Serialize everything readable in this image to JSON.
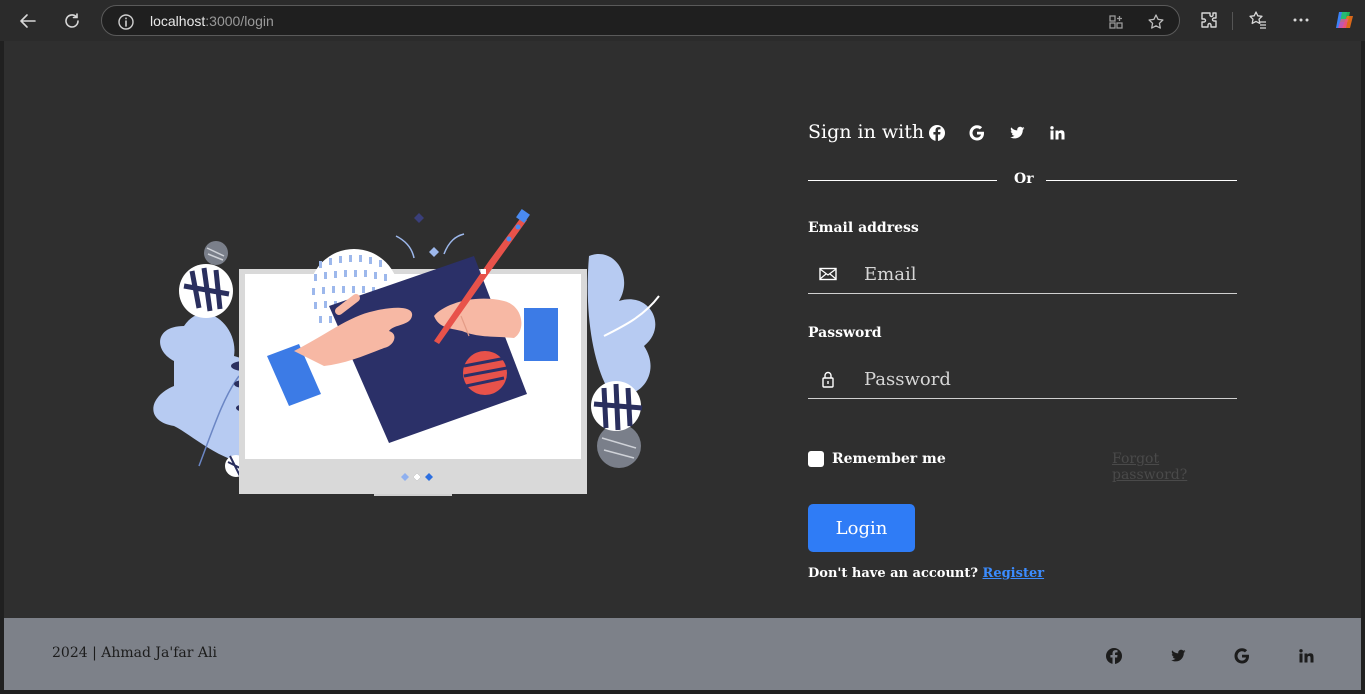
{
  "browser": {
    "url_host": "localhost",
    "url_path": ":3000/login",
    "icons": [
      "back-arrow-icon",
      "refresh-icon",
      "info-icon",
      "app-available-icon",
      "favorite-star-icon",
      "extensions-icon",
      "favorites-icon",
      "more-icon",
      "copilot-icon"
    ]
  },
  "login": {
    "signin_text": "Sign in with",
    "social_icons": [
      "facebook-icon",
      "google-icon",
      "twitter-icon",
      "linkedin-icon"
    ],
    "divider_text": "Or",
    "email_label": "Email address",
    "email_placeholder": "Email",
    "password_label": "Password",
    "password_placeholder": "Password",
    "remember_label": "Remember me",
    "forgot_link": "Forgot password?",
    "login_button": "Login",
    "register_prompt": "Don't have an account?",
    "register_link": "Register"
  },
  "footer": {
    "copyright": "2024 | Ahmad Ja'far Ali",
    "social_icons": [
      "facebook-icon",
      "twitter-icon",
      "google-icon",
      "linkedin-icon"
    ]
  },
  "colors": {
    "page_background": "#2f2f2f",
    "footer_background": "#7d8189",
    "primary_button": "#2f7cf6",
    "link": "#3b8cff"
  }
}
